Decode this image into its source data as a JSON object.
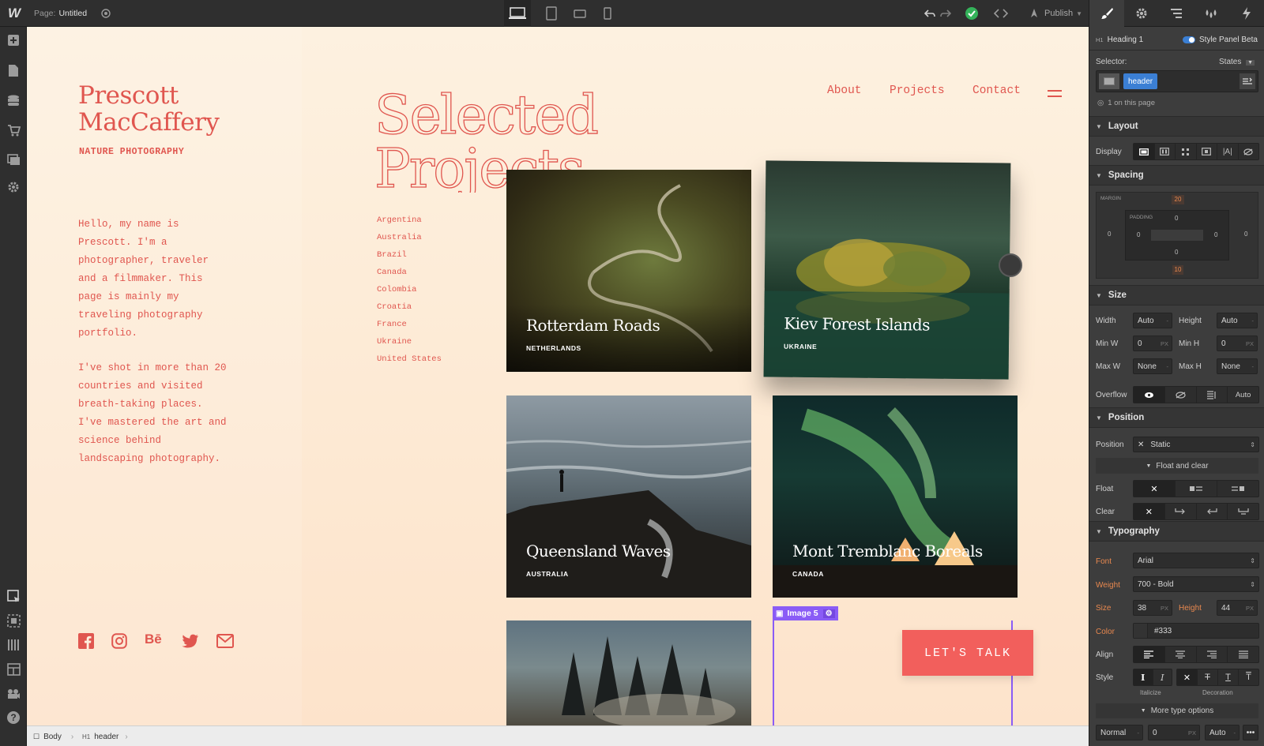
{
  "topbar": {
    "logo": "W",
    "page_label": "Page:",
    "page_name": "Untitled",
    "publish_label": "Publish"
  },
  "site": {
    "name_line1": "Prescott",
    "name_line2": "MacCaffery",
    "tagline": "NATURE PHOTOGRAPHY",
    "bio_paragraph1": [
      "Hello, my name is",
      "Prescott. I'm a",
      "photographer, traveler",
      "and a filmmaker. This",
      "page is mainly my",
      "traveling photography",
      "portfolio."
    ],
    "bio_paragraph2": [
      "I've shot in more than 20",
      "countries and visited",
      "breath-taking places.",
      "I've mastered the art and",
      "science behind",
      "landscaping photography."
    ],
    "heading_line1": "Selected",
    "heading_line2": "Projects",
    "nav": [
      "About",
      "Projects",
      "Contact"
    ],
    "countries": [
      "Argentina",
      "Australia",
      "Brazil",
      "Canada",
      "Colombia",
      "Croatia",
      "France",
      "Ukraine",
      "United States"
    ],
    "projects": [
      {
        "title": "Rotterdam Roads",
        "country": "NETHERLANDS"
      },
      {
        "title": "Kiev Forest Islands",
        "country": "UKRAINE"
      },
      {
        "title": "Queensland Waves",
        "country": "AUSTRALIA"
      },
      {
        "title": "Mont Tremblanc Boreals",
        "country": "CANADA"
      }
    ],
    "image_tag": "Image 5",
    "cta": "LET'S TALK"
  },
  "breadcrumb": [
    "Body",
    "header"
  ],
  "panel": {
    "element_tag": "H1",
    "element_name": "Heading 1",
    "style_panel_label": "Style Panel Beta",
    "selector_label": "Selector:",
    "states_label": "States",
    "selector_class": "header",
    "on_page": "1 on this page",
    "sections": {
      "layout": "Layout",
      "spacing": "Spacing",
      "size": "Size",
      "position": "Position",
      "typography": "Typography"
    },
    "display_label": "Display",
    "spacing": {
      "margin_label": "MARGIN",
      "padding_label": "PADDING",
      "margin_top": "20",
      "margin_bottom": "10",
      "margin_left": "0",
      "margin_right": "0",
      "padding_top": "0",
      "padding_bottom": "0",
      "padding_left": "0",
      "padding_right": "0"
    },
    "size": {
      "width_label": "Width",
      "width": "Auto",
      "height_label": "Height",
      "height": "Auto",
      "minw_label": "Min W",
      "minw": "0",
      "minh_label": "Min H",
      "minh": "0",
      "maxw_label": "Max W",
      "maxw": "None",
      "maxh_label": "Max H",
      "maxh": "None",
      "unit": "PX",
      "overflow_label": "Overflow",
      "overflow_auto": "Auto"
    },
    "position": {
      "position_label": "Position",
      "position_value": "Static",
      "float_clear_label": "Float and clear",
      "float_label": "Float",
      "clear_label": "Clear"
    },
    "typography": {
      "font_label": "Font",
      "font": "Arial",
      "weight_label": "Weight",
      "weight": "700 - Bold",
      "size_label": "Size",
      "size": "38",
      "height_label": "Height",
      "height": "44",
      "color_label": "Color",
      "color": "#333",
      "align_label": "Align",
      "style_label": "Style",
      "italicize_label": "Italicize",
      "decoration_label": "Decoration",
      "more_label": "More type options",
      "normal": "Normal",
      "letter_spacing": "0",
      "auto": "Auto"
    }
  },
  "colors": {
    "brand_red": "#e0564f",
    "cta_red": "#f25f5c",
    "selection_purple": "#8a5cf6",
    "selector_blue": "#3b7fd4",
    "publish_green": "#34b35a"
  }
}
